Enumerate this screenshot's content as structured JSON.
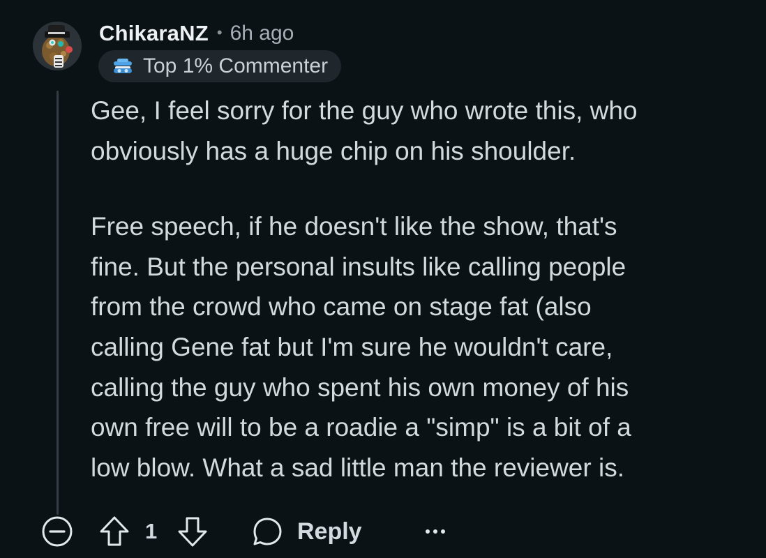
{
  "comment": {
    "username": "ChikaraNZ",
    "separator": "•",
    "timestamp": "6h ago",
    "flair": {
      "label": "Top 1% Commenter",
      "icon": "top-commenter-badge-icon"
    },
    "paragraphs": [
      "Gee, I feel sorry for the guy who wrote this, who\nobviously has a huge chip on his shoulder.",
      "Free speech, if he doesn't like the show, that's\nfine. But the personal insults like calling people\nfrom the crowd who came on stage fat (also\ncalling Gene fat but I'm sure he wouldn't care,\ncalling the guy who spent his own money of his\nown free will to be a roadie a \"simp\" is a bit of a\nlow blow. What a sad little man the reviewer is."
    ]
  },
  "actions": {
    "collapse_icon": "collapse-minus-icon",
    "upvote_icon": "upvote-arrow-icon",
    "score": "1",
    "downvote_icon": "downvote-arrow-icon",
    "reply_icon": "speech-bubble-icon",
    "reply_label": "Reply",
    "more_icon": "more-options-icon"
  },
  "colors": {
    "background": "#0b1216",
    "text": "#d3dade",
    "muted": "#a7b0b6",
    "flair_bg": "#1f272d",
    "thread_line": "#343d43"
  }
}
